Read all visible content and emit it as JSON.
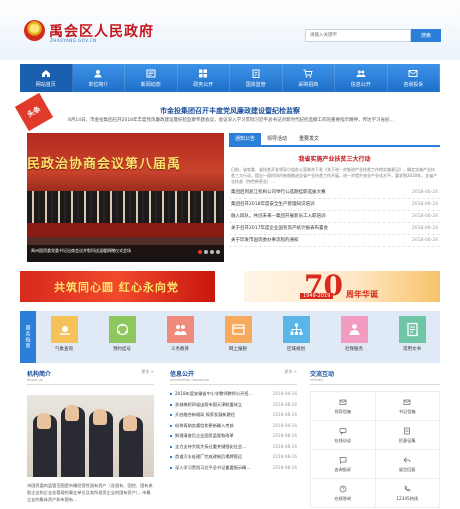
{
  "header": {
    "site_name": "禹会区人民政府",
    "site_url": "ZHAOYANG.GOV.CN",
    "search_placeholder": "请输入关键字",
    "search_button": "搜索"
  },
  "nav": [
    {
      "label": "网站首页",
      "icon": "home-icon",
      "active": true
    },
    {
      "label": "单位简介",
      "icon": "user-icon"
    },
    {
      "label": "新闻动态",
      "icon": "news-icon"
    },
    {
      "label": "政务公开",
      "icon": "grid-icon"
    },
    {
      "label": "国资监管",
      "icon": "clipboard-icon"
    },
    {
      "label": "采购招商",
      "icon": "cart-icon"
    },
    {
      "label": "信息公开",
      "icon": "people-icon"
    },
    {
      "label": "咨询投诉",
      "icon": "mail-icon"
    }
  ],
  "headline": {
    "badge": "头条",
    "title": "市金投集团召开丰度党风廉政建设暨纪检监察",
    "summary": "8月14日，市金投集团召开2018年丰度党风廉政建设暨纪检监察专题会议，会议深入学习贯彻习近平总书记对新时代纪检监察工作的重要指示精神，传达学习省纪…"
  },
  "slider": {
    "banner_text": "民政治协商会议第八届禹",
    "caption": "禹州国资委党委书记出席会议并慰问送温暖捐赠仪式会场",
    "dots": 4,
    "active_dot": 0
  },
  "news": {
    "tabs": [
      "通知公告",
      "领导活动",
      "重要发文"
    ],
    "active_tab": 0,
    "featured_title": "我省实施产业扶贫三大行动",
    "featured_summary": "日前，省农委、省扶贫开发领导小组办公室联合下发《关于进一步推进产业扶贫工作的实施意见》，确定实施产业扶贫三大行动，提出一段时间内有效推进全省产业扶贫工作开展，进一步提升农业产业化水平，要求到2020年，全省产业扶贫（特色种养业）…",
    "items": [
      {
        "title": "集团后到浙江机构公司举行公选期挂职选拔大赛",
        "date": "2018-06-24"
      },
      {
        "title": "集团召开2018年度安全生产管理知识培训",
        "date": "2018-06-24"
      },
      {
        "title": "融入四队，共创未来—集团开展新员工入职培训",
        "date": "2018-06-24"
      },
      {
        "title": "关于召开2017年度企业国有资产统计报表布置会",
        "date": "2018-06-24"
      },
      {
        "title": "关于印发市国资委办事流程的通知",
        "date": "2018-06-24"
      }
    ]
  },
  "banners": {
    "left_text": "共筑同心圆  红心永向党",
    "right_big": "70",
    "right_years": "1949-2019",
    "right_sub": "周年华诞"
  },
  "services": {
    "label": "服务指南",
    "items": [
      {
        "label": "气象查询",
        "icon": "weather-icon",
        "bg": "#f5c25a"
      },
      {
        "label": "预约挂号",
        "icon": "hospital-icon",
        "bg": "#8dc75e"
      },
      {
        "label": "义务教育",
        "icon": "education-icon",
        "bg": "#f08a7a"
      },
      {
        "label": "网上报税",
        "icon": "tax-icon",
        "bg": "#f7a95e"
      },
      {
        "label": "区域规划",
        "icon": "plan-icon",
        "bg": "#5ab6e8"
      },
      {
        "label": "社保服务",
        "icon": "social-icon",
        "bg": "#f29bc0"
      },
      {
        "label": "常用文书",
        "icon": "document-icon",
        "bg": "#6ec6a6"
      }
    ]
  },
  "intro": {
    "title": "机构简介",
    "subtitle": "About us",
    "more": "更多 >",
    "text": "市国资委的监管范围是市属经营性国有资产（含国有、国控、国有参股企业和企业化管理的事业单位及其所投资企业的国有资产），市属企业的集体资产和市国有…"
  },
  "info": {
    "title": "信息公开",
    "subtitle": "Information disclosure",
    "more": "更多 >",
    "items": [
      {
        "title": "2018年度安徽省中小学教师教师公开招…",
        "date": "2018-08-16"
      },
      {
        "title": "浙城梅桥四省出版市国天津联盟成立",
        "date": "2018-08-16"
      },
      {
        "title": "开启融合新格局 探索发展新路径",
        "date": "2018-08-16"
      },
      {
        "title": "俗称再助务督信和更新确入考核",
        "date": "2018-08-16"
      },
      {
        "title": "鲜理清查后企业国资监管和改革",
        "date": "2018-08-16"
      },
      {
        "title": "全力支持大陆大拆迁重关键细化社会…",
        "date": "2018-08-16"
      },
      {
        "title": "首道污水处理厂完成改制后揭牌营运",
        "date": "2018-08-16"
      },
      {
        "title": "深入学习贯彻习近平总书记重要指示精…",
        "date": "2018-08-16"
      }
    ]
  },
  "interact": {
    "title": "交流互动",
    "subtitle": "Interact",
    "items": [
      {
        "label": "领导信箱",
        "icon": "envelope-icon"
      },
      {
        "label": "书记信箱",
        "icon": "envelope-icon"
      },
      {
        "label": "在线访谈",
        "icon": "chat-icon"
      },
      {
        "label": "民意征集",
        "icon": "poll-icon"
      },
      {
        "label": "咨询投诉",
        "icon": "complaint-icon"
      },
      {
        "label": "留言回复",
        "icon": "reply-icon"
      },
      {
        "label": "在线答询",
        "icon": "question-icon"
      },
      {
        "label": "12345热线",
        "icon": "phone-icon"
      }
    ]
  },
  "colors": {
    "primary": "#2b7fd9",
    "brand_red": "#c5161d",
    "nav_dark": "#1f6fc9"
  }
}
